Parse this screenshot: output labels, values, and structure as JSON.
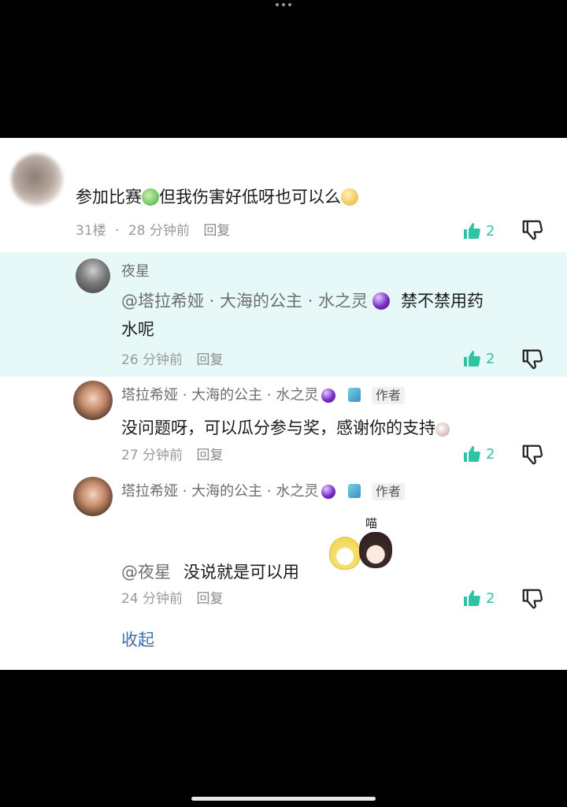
{
  "comment_main": {
    "text": "参加比赛",
    "text_tail": "但我伤害好低呀也可以么",
    "floor": "31楼",
    "time": "28 分钟前",
    "reply_label": "回复",
    "likes": "2"
  },
  "replies": [
    {
      "name": "夜星",
      "mention": "@塔拉希娅 · 大海的公主 · 水之灵",
      "text_line1": "禁不禁用药",
      "text_line2": "水呢",
      "time": "26 分钟前",
      "reply_label": "回复",
      "likes": "2",
      "highlighted": true
    },
    {
      "name": "塔拉希娅 · 大海的公主 · 水之灵",
      "badge": "作者",
      "text": "没问题呀，可以瓜分参与奖，感谢你的支持",
      "time": "27 分钟前",
      "reply_label": "回复",
      "likes": "2"
    },
    {
      "name": "塔拉希娅 · 大海的公主 · 水之灵",
      "badge": "作者",
      "sticker_text": "喵",
      "mention": "@夜星",
      "text": "没说就是可以用",
      "time": "24 分钟前",
      "reply_label": "回复",
      "likes": "2"
    }
  ],
  "collapse_label": "收起",
  "colors": {
    "accent": "#2fc3a4",
    "highlight_bg": "#e6f8f7",
    "link": "#3f6fa8"
  }
}
